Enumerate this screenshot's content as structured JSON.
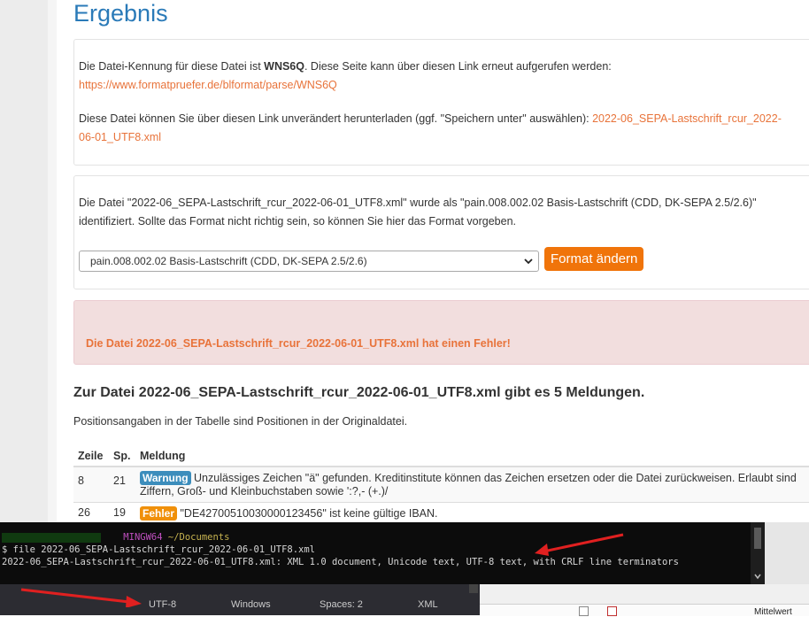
{
  "title": "Ergebnis",
  "panel1": {
    "kennung_prefix": "Die Datei-Kennung für diese Datei ist ",
    "kennung": "WNS6Q",
    "kennung_suffix": ". Diese Seite kann über diesen Link erneut aufgerufen werden:",
    "kennung_link": "https://www.formatpruefer.de/blformat/parse/WNS6Q",
    "download_text": "Diese Datei können Sie über diesen Link unverändert herunterladen (ggf. \"Speichern unter\" auswählen): ",
    "download_link_1": "2022-06_SEPA-Lastschrift_rcur_2022-",
    "download_link_2": "06-01_UTF8.xml"
  },
  "panel2": {
    "identified_line1": "Die Datei \"2022-06_SEPA-Lastschrift_rcur_2022-06-01_UTF8.xml\" wurde als \"pain.008.002.02 Basis-Lastschrift (CDD, DK-SEPA 2.5/2.6)\"",
    "identified_line2": "identifiziert. Sollte das Format nicht richtig sein, so können Sie hier das Format vorgeben.",
    "select_value": "pain.008.002.02 Basis-Lastschrift (CDD, DK-SEPA 2.5/2.6)",
    "button_label": "Format ändern"
  },
  "alert": "Die Datei 2022-06_SEPA-Lastschrift_rcur_2022-06-01_UTF8.xml hat einen Fehler!",
  "subheading": "Zur Datei 2022-06_SEPA-Lastschrift_rcur_2022-06-01_UTF8.xml gibt es 5 Meldungen.",
  "info": "Positionsangaben in der Tabelle sind Positionen in der Originaldatei.",
  "table": {
    "headers": [
      "Zeile",
      "Sp.",
      "Meldung"
    ],
    "rows": [
      {
        "zeile": "8",
        "sp": "21",
        "label": "Warnung",
        "text": " Unzulässiges Zeichen \"ä\" gefunden. Kreditinstitute können das Zeichen ersetzen oder die Datei zurückweisen. Erlaubt sind Ziffern, Groß- und Kleinbuchstaben sowie ':?,- (+.)/"
      },
      {
        "zeile": "26",
        "sp": "19",
        "label": "Fehler",
        "text": " \"DE42700510030000123456\" ist keine gültige IBAN."
      }
    ]
  },
  "terminal": {
    "prompt_env": "MINGW64",
    "prompt_cwd": "~/Documents",
    "command": "$ file 2022-06_SEPA-Lastschrift_rcur_2022-06-01_UTF8.xml",
    "output": "2022-06_SEPA-Lastschrift_rcur_2022-06-01_UTF8.xml: XML 1.0 document, Unicode text, UTF-8 text, with CRLF line terminators"
  },
  "statusbar": {
    "encoding": "UTF-8",
    "eol": "Windows",
    "indent": "Spaces: 2",
    "language": "XML"
  },
  "bottom_right": {
    "text": "Mittelwert"
  },
  "colors": {
    "link": "#e8733a",
    "title": "#2a7ab8",
    "button": "#f0740a",
    "warning_label": "#3c8dbc",
    "error_label": "#f0900a",
    "alert_bg": "#f2dede",
    "arrow": "#e02020"
  },
  "icons": [
    "red-arrow-icon",
    "chevron-down-icon",
    "scroll-down-icon"
  ]
}
